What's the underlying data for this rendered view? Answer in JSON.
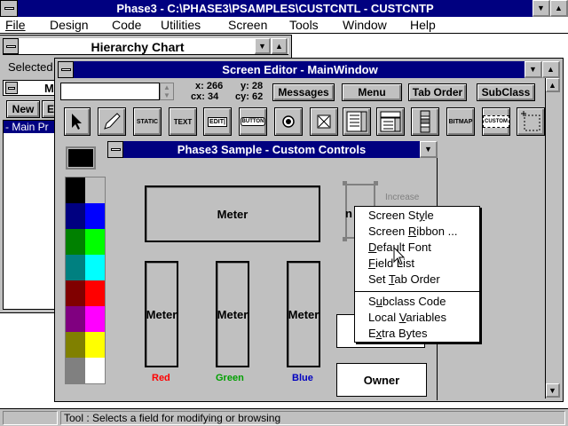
{
  "app": {
    "title": "Phase3 - C:\\PHASE3\\PSAMPLES\\CUSTCNTL - CUSTCNTP"
  },
  "menubar": [
    "File",
    "Design",
    "Code",
    "Utilities",
    "Screen",
    "Tools",
    "Window",
    "Help"
  ],
  "hierarchy": {
    "title": "Hierarchy Chart",
    "selected_label": "Selected",
    "field_text": "M",
    "new_button": "New",
    "e_button": "E",
    "list_item": "- Main Pr"
  },
  "screen_editor": {
    "title": "Screen Editor - MainWindow",
    "coords": {
      "x_label": "x: 266",
      "y_label": "y: 28",
      "cx_label": "cx: 34",
      "cy_label": "cy: 62"
    },
    "buttons": [
      "Messages",
      "Menu",
      "Tab Order",
      "SubClass"
    ],
    "tools": [
      "select-arrow",
      "pen",
      "STATIC",
      "TEXT",
      "EDIT",
      "BUTTON",
      "radio",
      "checkbox",
      "listbox",
      "combobox",
      "scrollbar",
      "BITMAP",
      "CUSTOM",
      "frame"
    ]
  },
  "sample_window": {
    "title": "Phase3 Sample - Custom Controls",
    "meter_label": "Meter",
    "increase_label": "Increase",
    "partial_label": "n",
    "color_labels": {
      "red": "Red",
      "green": "Green",
      "blue": "Blue"
    },
    "owner_label": "Owner"
  },
  "palette": {
    "current": "#000000",
    "colors": [
      [
        "#000000",
        "#c0c0c0"
      ],
      [
        "#000080",
        "#0000ff"
      ],
      [
        "#008000",
        "#00ff00"
      ],
      [
        "#008080",
        "#00ffff"
      ],
      [
        "#800000",
        "#ff0000"
      ],
      [
        "#800080",
        "#ff00ff"
      ],
      [
        "#808000",
        "#ffff00"
      ],
      [
        "#808080",
        "#ffffff"
      ]
    ]
  },
  "context_menu": {
    "group1": [
      {
        "pre": "Screen St",
        "u": "y",
        "post": "le"
      },
      {
        "pre": "Screen ",
        "u": "R",
        "post": "ibbon ..."
      },
      {
        "pre": "",
        "u": "D",
        "post": "efault Font"
      },
      {
        "pre": "",
        "u": "F",
        "post": "ield List"
      },
      {
        "pre": "Set ",
        "u": "T",
        "post": "ab Order"
      }
    ],
    "group2": [
      {
        "pre": "S",
        "u": "u",
        "post": "bclass Code"
      },
      {
        "pre": "Local ",
        "u": "V",
        "post": "ariables"
      },
      {
        "pre": "E",
        "u": "x",
        "post": "tra Bytes"
      }
    ]
  },
  "status": {
    "text": "Tool : Selects a field for modifying or browsing"
  },
  "colors": {
    "title_active": "#000080",
    "red": "#ff0000",
    "green": "#00a000",
    "blue": "#0000c0"
  }
}
